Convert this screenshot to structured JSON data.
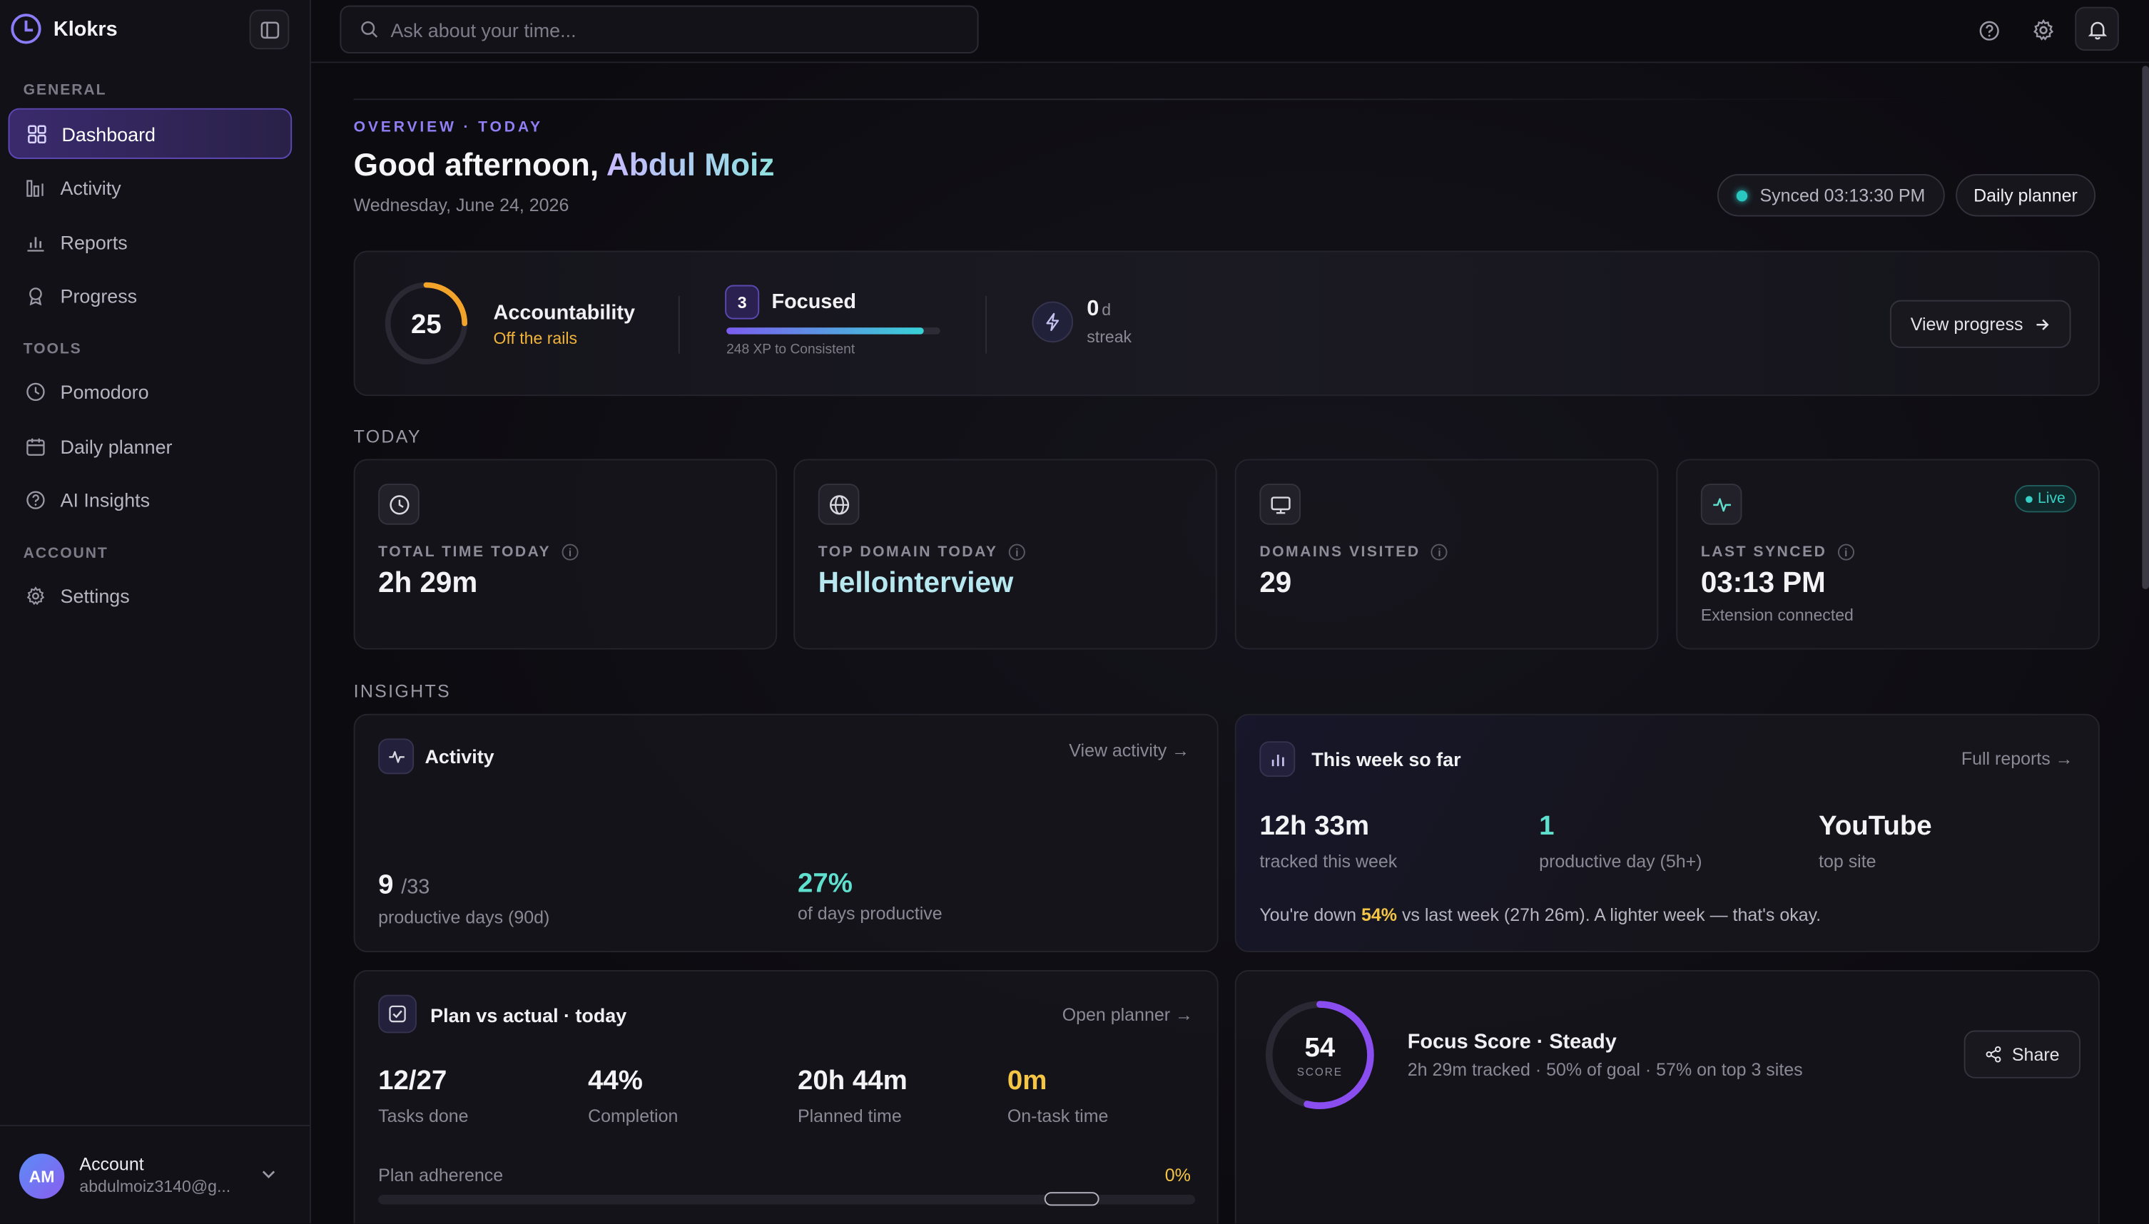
{
  "brand": {
    "name": "Klokrs"
  },
  "sidebar": {
    "sections": [
      {
        "label": "GENERAL",
        "items": [
          {
            "label": "Dashboard",
            "icon": "grid-icon",
            "active": true
          },
          {
            "label": "Activity",
            "icon": "bars-icon"
          },
          {
            "label": "Reports",
            "icon": "chart-icon"
          },
          {
            "label": "Progress",
            "icon": "badge-icon"
          }
        ]
      },
      {
        "label": "TOOLS",
        "items": [
          {
            "label": "Pomodoro",
            "icon": "clock-icon"
          },
          {
            "label": "Daily planner",
            "icon": "calendar-icon"
          },
          {
            "label": "AI Insights",
            "icon": "help-circle-icon"
          }
        ]
      },
      {
        "label": "ACCOUNT",
        "items": [
          {
            "label": "Settings",
            "icon": "gear-icon"
          }
        ]
      }
    ],
    "account": {
      "initials": "AM",
      "name": "Account",
      "email": "abdulmoiz3140@g..."
    }
  },
  "topbar": {
    "search_placeholder": "Ask about your time..."
  },
  "header": {
    "eyebrow": "OVERVIEW · TODAY",
    "greeting": "Good afternoon,",
    "user_name": "Abdul Moiz",
    "date": "Wednesday, June 24, 2026",
    "synced": "Synced 03:13:30 PM",
    "planner_button": "Daily planner"
  },
  "hero": {
    "score": "25",
    "score_fraction": 0.25,
    "accountability_title": "Accountability",
    "accountability_status": "Off the rails",
    "level": "3",
    "level_name": "Focused",
    "xp_fraction": 0.92,
    "xp_text": "248 XP to Consistent",
    "streak_value": "0",
    "streak_unit": "d",
    "streak_label": "streak",
    "view_progress": "View progress"
  },
  "today": {
    "title": "TODAY",
    "cards": [
      {
        "label": "TOTAL TIME TODAY",
        "value": "2h 29m",
        "icon": "clock-icon"
      },
      {
        "label": "TOP DOMAIN TODAY",
        "value": "Hellointerview",
        "icon": "globe-icon"
      },
      {
        "label": "DOMAINS VISITED",
        "value": "29",
        "icon": "monitor-icon"
      },
      {
        "label": "LAST SYNCED",
        "value": "03:13 PM",
        "sub": "Extension connected",
        "icon": "pulse-icon",
        "badge": "Live"
      }
    ]
  },
  "insights": {
    "title": "INSIGHTS",
    "activity": {
      "title": "Activity",
      "link": "View activity →",
      "productive_days": "9",
      "productive_days_total": "/33",
      "productive_days_caption": "productive days (90d)",
      "percent": "27%",
      "percent_caption": "of days productive"
    },
    "week": {
      "title": "This week so far",
      "link": "Full reports →",
      "tracked": "12h 33m",
      "tracked_caption": "tracked this week",
      "productive": "1",
      "productive_caption": "productive day (5h+)",
      "top_site": "YouTube",
      "top_site_caption": "top site",
      "note_prefix": "You're down ",
      "note_percent": "54%",
      "note_suffix": " vs last week (27h 26m). A lighter week — that's okay."
    },
    "plan": {
      "title": "Plan vs actual · today",
      "link": "Open planner →",
      "tasks": "12/27",
      "tasks_caption": "Tasks done",
      "completion": "44%",
      "completion_caption": "Completion",
      "planned": "20h 44m",
      "planned_caption": "Planned time",
      "ontask": "0m",
      "ontask_caption": "On-task time",
      "adherence_label": "Plan adherence",
      "adherence_value": "0%"
    },
    "focus": {
      "score": "54",
      "score_label": "SCORE",
      "score_fraction": 0.54,
      "title": "Focus Score · Steady",
      "subtitle": "2h 29m tracked · 50% of goal · 57% on top 3 sites",
      "share": "Share"
    }
  },
  "colors": {
    "accent": "#8b7cf7",
    "teal": "#36d1c6",
    "gold": "#f5c545",
    "orange": "#f2a32a"
  }
}
